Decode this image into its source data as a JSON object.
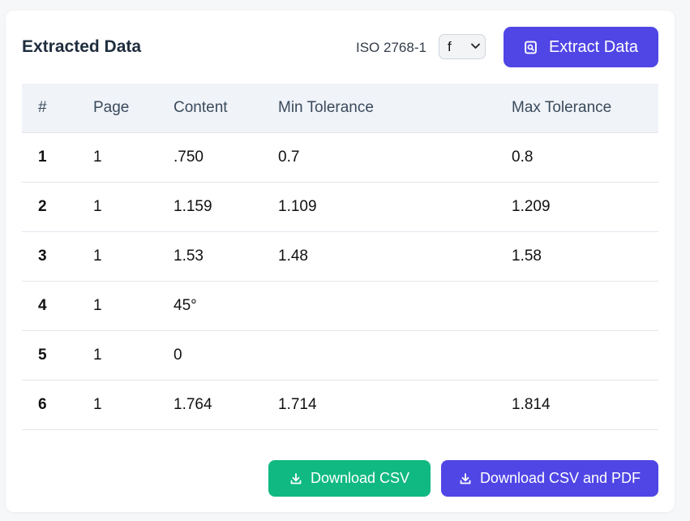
{
  "header": {
    "title": "Extracted Data",
    "iso_label": "ISO 2768-1",
    "tolerance_class": "f",
    "extract_button": "Extract Data",
    "extract_icon": "scan-document-icon"
  },
  "table": {
    "columns": [
      "#",
      "Page",
      "Content",
      "Min Tolerance",
      "Max Tolerance"
    ],
    "rows": [
      {
        "num": "1",
        "page": "1",
        "content": ".750",
        "min": "0.7",
        "max": "0.8"
      },
      {
        "num": "2",
        "page": "1",
        "content": "1.159",
        "min": "1.109",
        "max": "1.209"
      },
      {
        "num": "3",
        "page": "1",
        "content": "1.53",
        "min": "1.48",
        "max": "1.58"
      },
      {
        "num": "4",
        "page": "1",
        "content": "45°",
        "min": "",
        "max": ""
      },
      {
        "num": "5",
        "page": "1",
        "content": "0",
        "min": "",
        "max": ""
      },
      {
        "num": "6",
        "page": "1",
        "content": "1.764",
        "min": "1.714",
        "max": "1.814"
      }
    ]
  },
  "actions": {
    "download_csv": "Download CSV",
    "download_csv_pdf": "Download CSV and PDF",
    "download_icon": "download-icon"
  },
  "colors": {
    "primary": "#5046e5",
    "success": "#10b981",
    "header_bg": "#f0f3f8"
  }
}
